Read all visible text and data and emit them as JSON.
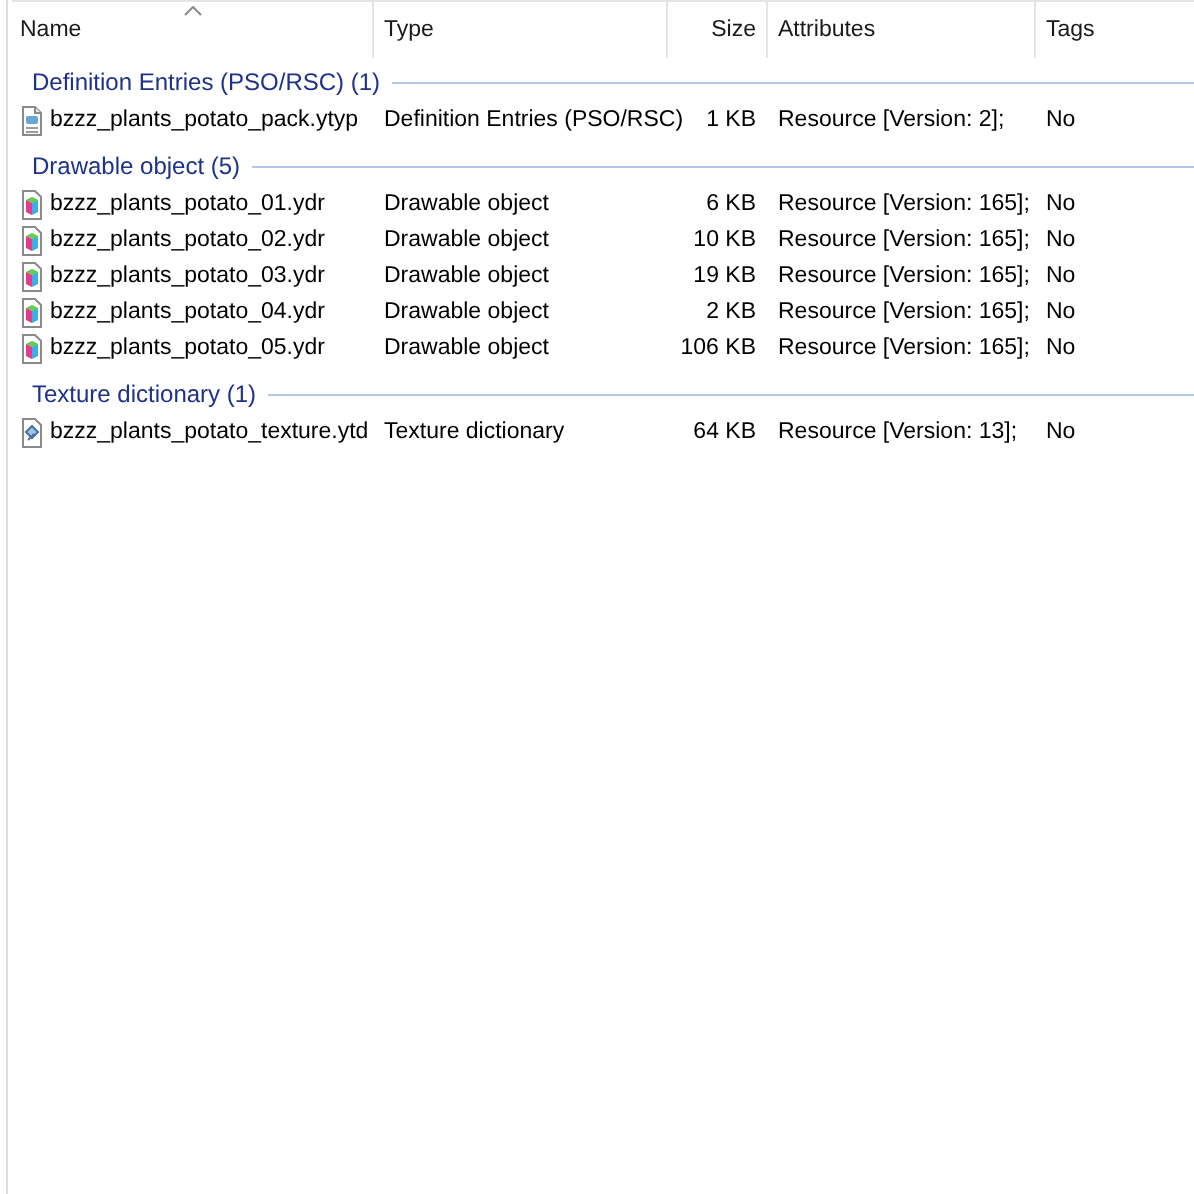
{
  "columns": [
    {
      "label": "Name",
      "sorted": true
    },
    {
      "label": "Type",
      "sorted": false
    },
    {
      "label": "Size",
      "sorted": false
    },
    {
      "label": "Attributes",
      "sorted": false
    },
    {
      "label": "Tags",
      "sorted": false
    }
  ],
  "groups": [
    {
      "title": "Definition Entries (PSO/RSC) (1)",
      "files": [
        {
          "kind": "ytyp",
          "name": "bzzz_plants_potato_pack.ytyp",
          "type": "Definition Entries (PSO/RSC)",
          "size": "1 KB",
          "attributes": "Resource [Version: 2];",
          "tags": "No"
        }
      ]
    },
    {
      "title": "Drawable object (5)",
      "files": [
        {
          "kind": "ydr",
          "name": "bzzz_plants_potato_01.ydr",
          "type": "Drawable object",
          "size": "6 KB",
          "attributes": "Resource [Version: 165];",
          "tags": "No"
        },
        {
          "kind": "ydr",
          "name": "bzzz_plants_potato_02.ydr",
          "type": "Drawable object",
          "size": "10 KB",
          "attributes": "Resource [Version: 165];",
          "tags": "No"
        },
        {
          "kind": "ydr",
          "name": "bzzz_plants_potato_03.ydr",
          "type": "Drawable object",
          "size": "19 KB",
          "attributes": "Resource [Version: 165];",
          "tags": "No"
        },
        {
          "kind": "ydr",
          "name": "bzzz_plants_potato_04.ydr",
          "type": "Drawable object",
          "size": "2 KB",
          "attributes": "Resource [Version: 165];",
          "tags": "No"
        },
        {
          "kind": "ydr",
          "name": "bzzz_plants_potato_05.ydr",
          "type": "Drawable object",
          "size": "106 KB",
          "attributes": "Resource [Version: 165];",
          "tags": "No"
        }
      ]
    },
    {
      "title": "Texture dictionary (1)",
      "files": [
        {
          "kind": "ytd",
          "name": "bzzz_plants_potato_texture.ytd",
          "type": "Texture dictionary",
          "size": "64 KB",
          "attributes": "Resource [Version: 13];",
          "tags": "No"
        }
      ]
    }
  ]
}
